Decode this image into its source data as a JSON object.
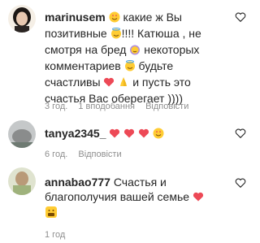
{
  "comments": [
    {
      "username": "marinusem",
      "lines": [
        "какие ж Вы",
        "позитивные",
        "!!!! Катюша , не",
        "смотря на бред",
        "некоторых",
        "комментариев",
        "будьте",
        "счастливы",
        "и пусть это",
        "счастья Вас оберегает ))))"
      ],
      "time": "3 год.",
      "likes": "1 вподобання",
      "reply": "Відповісти"
    },
    {
      "username": "tanya2345_",
      "lines": [],
      "time": "6 год.",
      "reply": "Відповісти"
    },
    {
      "username": "annabao777",
      "lines": [
        "Счастья и",
        "благополучия вашей семье"
      ],
      "time": "1 год"
    }
  ],
  "colors": {
    "meta": "#8e8e8e",
    "heart": "#ed4956",
    "emoji_yellow": "#ffcc33"
  },
  "icons": [
    "heart-outline-icon",
    "smiling-heart-eyes-emoji",
    "red-heart-emoji",
    "praying-hands-emoji",
    "smiling-face-halo-emoji",
    "hugging-face-emoji"
  ]
}
